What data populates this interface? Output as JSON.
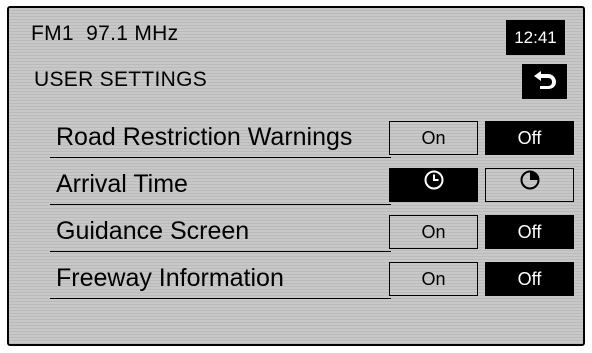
{
  "header": {
    "station": "FM1  97.1 MHz",
    "clock": "12:41"
  },
  "page": {
    "title": "USER SETTINGS",
    "back_icon": "back-arrow-icon"
  },
  "settings": [
    {
      "label": "Road Restriction Warnings",
      "options": [
        "On",
        "Off"
      ],
      "selected": "Off"
    },
    {
      "label": "Arrival Time",
      "options": [
        "clock-icon",
        "clock-partial-icon"
      ],
      "selected": "clock-icon"
    },
    {
      "label": "Guidance Screen",
      "options": [
        "On",
        "Off"
      ],
      "selected": "Off"
    },
    {
      "label": "Freeway Information",
      "options": [
        "On",
        "Off"
      ],
      "selected": "Off"
    }
  ],
  "colors": {
    "panel": "#c8c8c8",
    "selected": "#000000",
    "text": "#000000"
  }
}
